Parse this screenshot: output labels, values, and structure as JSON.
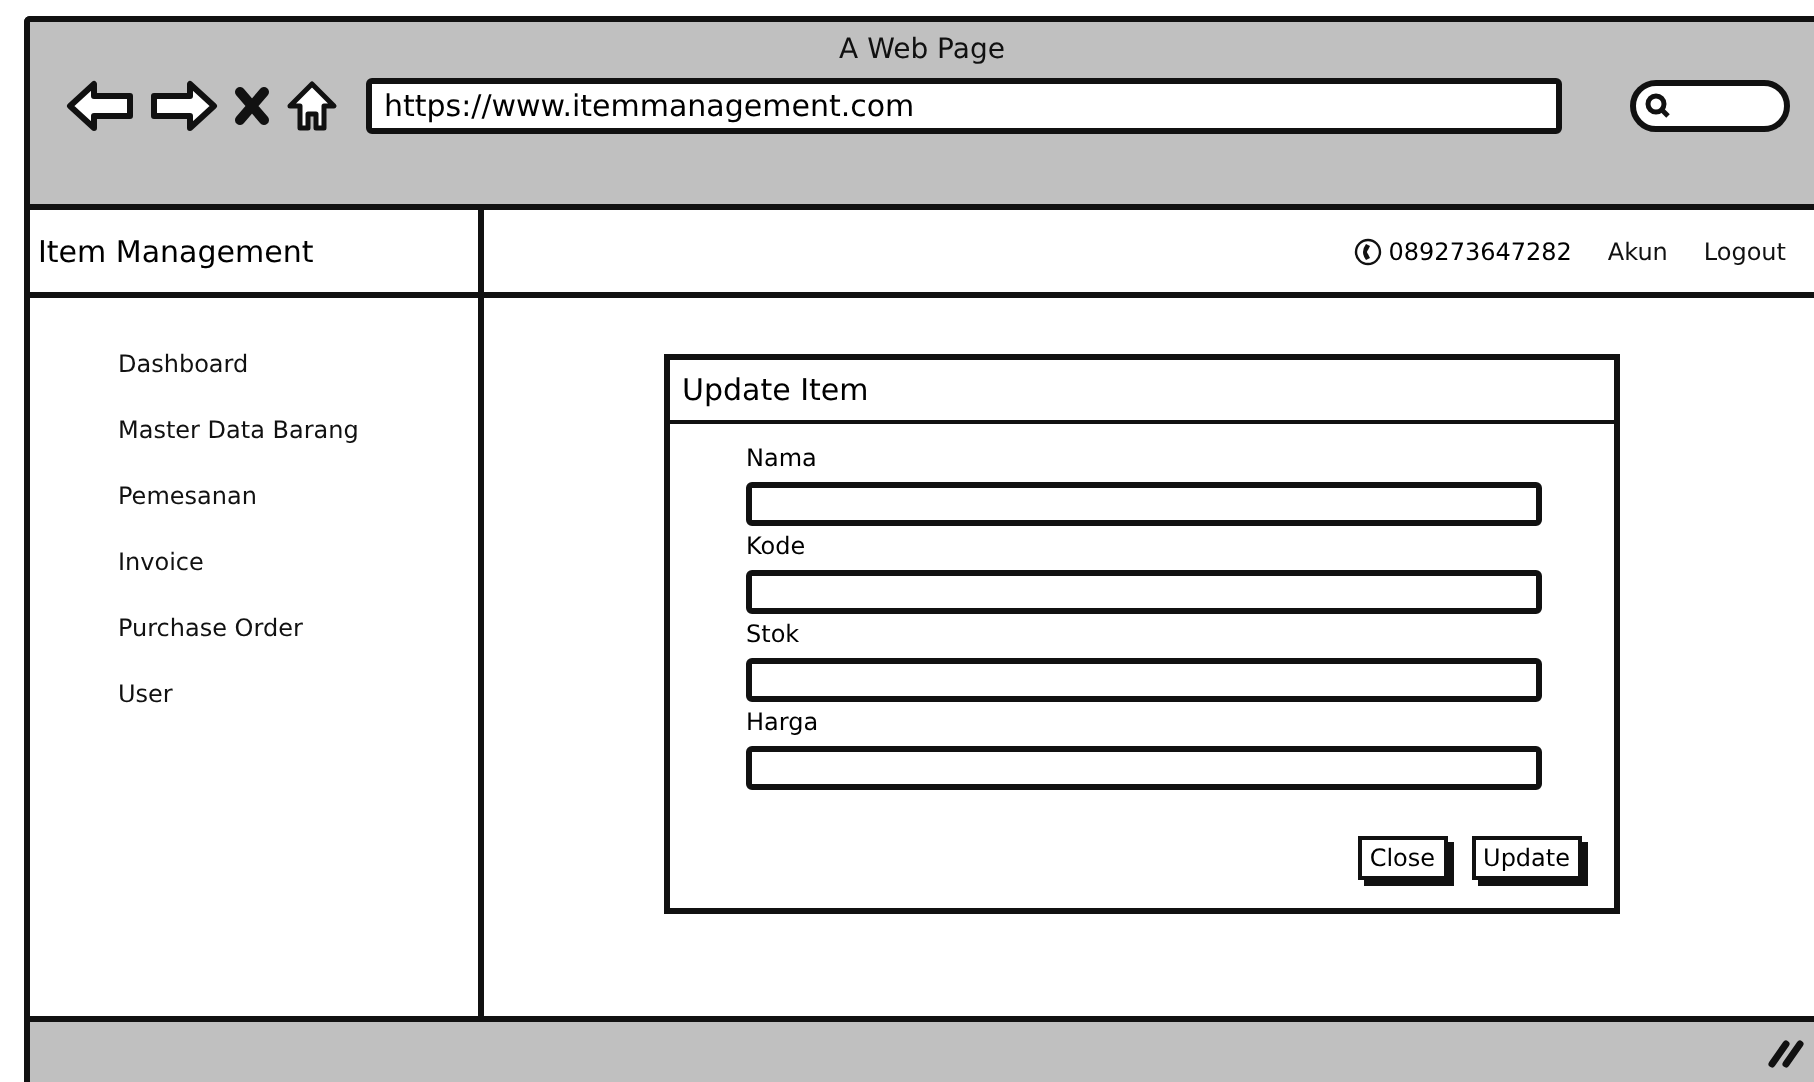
{
  "window": {
    "title": "A Web Page",
    "url": "https://www.itemmanagement.com"
  },
  "app": {
    "title": "Item Management"
  },
  "header": {
    "phone": "089273647282",
    "links": [
      "Akun",
      "Logout"
    ]
  },
  "sidebar": {
    "items": [
      "Dashboard",
      "Master Data Barang",
      "Pemesanan",
      "Invoice",
      "Purchase Order",
      "User"
    ]
  },
  "dialog": {
    "title": "Update Item",
    "fields": [
      {
        "label": "Nama"
      },
      {
        "label": "Kode"
      },
      {
        "label": "Stok"
      },
      {
        "label": "Harga"
      }
    ],
    "buttons": [
      "Close",
      "Update"
    ]
  }
}
